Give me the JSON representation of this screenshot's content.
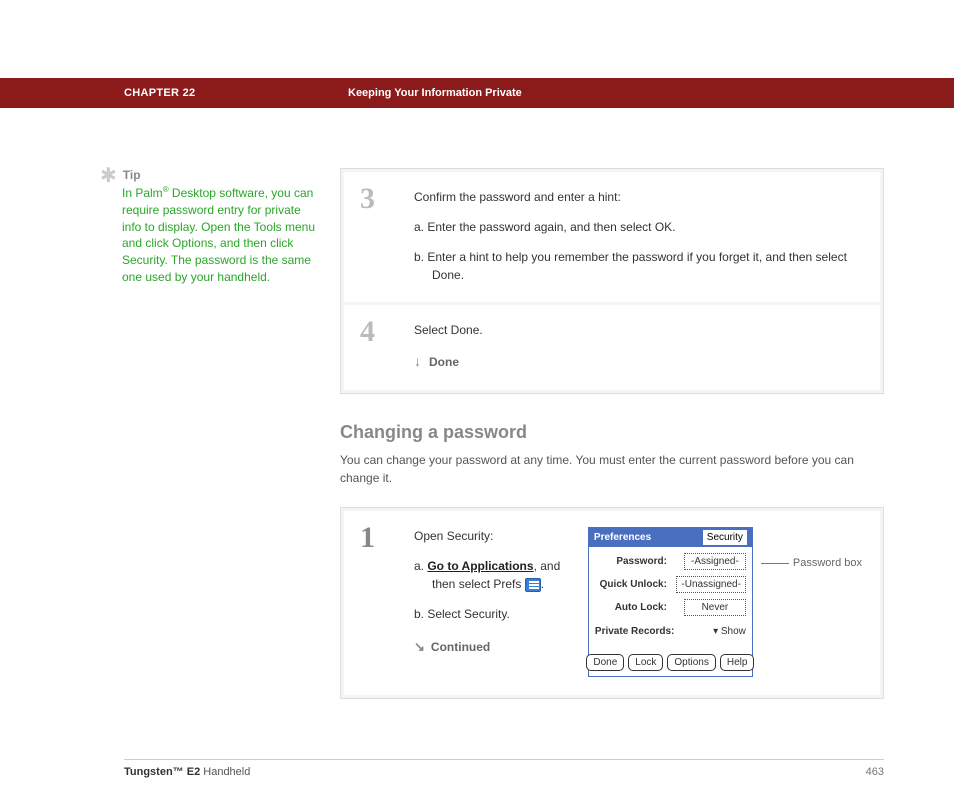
{
  "header": {
    "chapter": "CHAPTER 22",
    "title": "Keeping Your Information Private"
  },
  "tip": {
    "label": "Tip",
    "prefix": "In Palm",
    "regmark": "®",
    "body": " Desktop software, you can require password entry for private info to display. Open the Tools menu and click Options, and then click Security. The password is the same one used by your handheld."
  },
  "steps_a": {
    "s3": {
      "num": "3",
      "lead": "Confirm the password and enter a hint:",
      "a": "a.  Enter the password again, and then select OK.",
      "b": "b.  Enter a hint to help you remember the password if you forget it, and then select Done."
    },
    "s4": {
      "num": "4",
      "lead": "Select Done.",
      "done": "Done"
    }
  },
  "section": {
    "heading": "Changing a password",
    "desc": "You can change your password at any time. You must enter the current password before you can change it."
  },
  "steps_b": {
    "s1": {
      "num": "1",
      "lead": "Open Security:",
      "a_pre": "a.  ",
      "a_link": "Go to Applications",
      "a_post": ", and then select Prefs ",
      "a_end": ".",
      "b": "b.  Select Security.",
      "continued": "Continued"
    }
  },
  "palm": {
    "title_left": "Preferences",
    "title_right": "Security",
    "rows": {
      "password_label": "Password:",
      "password_value": "-Assigned-",
      "quick_label": "Quick Unlock:",
      "quick_value": "-Unassigned-",
      "auto_label": "Auto Lock:",
      "auto_value": "Never",
      "private_label": "Private Records:",
      "private_value": "Show"
    },
    "buttons": {
      "done": "Done",
      "lock": "Lock",
      "options": "Options",
      "help": "Help"
    },
    "callout": "Password box"
  },
  "footer": {
    "product_bold": "Tungsten™ E2",
    "product_rest": " Handheld",
    "page": "463"
  }
}
